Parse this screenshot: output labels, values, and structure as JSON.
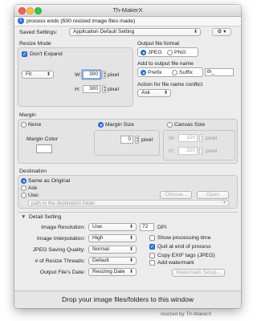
{
  "window": {
    "title": "Th-MakerX"
  },
  "info": {
    "message": "process ends (500 resized image files made)"
  },
  "saved_settings": {
    "label": "Saved Settings:",
    "value": "Application Default Setting"
  },
  "gear_menu": {
    "label": "⚙ ▾"
  },
  "resize_mode": {
    "title": "Resize Mode",
    "dont_expand": {
      "label": "Don't Expand",
      "checked": true
    },
    "fit_value": "Fit",
    "width_label": "W:",
    "width_value": "300",
    "width_unit": "pixel",
    "height_label": "H:",
    "height_value": "300",
    "height_unit": "pixel"
  },
  "output_format": {
    "title": "Output file format",
    "jpeg": "JPEG",
    "png": "PNG",
    "selected": "JPEG"
  },
  "add_to_name": {
    "title": "Add to output file name",
    "prefix": "Prefix",
    "suffix": "Suffix",
    "selected": "Prefix",
    "text_value": "th_"
  },
  "conflict": {
    "title": "Action for file name conflict",
    "value": "Ask"
  },
  "margin": {
    "title": "Margin",
    "none": "None",
    "margin_size": "Margin Size",
    "canvas_size": "Canvas Size",
    "selected": "Margin Size",
    "margin_color_label": "Margin Color",
    "margin_value": "0",
    "margin_unit": "pixel",
    "canvas_w_label": "W:",
    "canvas_w_value": "320",
    "canvas_w_unit": "pixel",
    "canvas_h_label": "H:",
    "canvas_h_value": "320",
    "canvas_h_unit": "pixel"
  },
  "destination": {
    "title": "Destination",
    "same": "Same as Original",
    "ask": "Ask",
    "use": "Use:",
    "selected": "Same as Original",
    "choose_label": "Choose...",
    "open_label": "Open",
    "path_placeholder": "path to the destination folder"
  },
  "detail": {
    "title": "Detail Setting",
    "resolution_label": "Image Resolution:",
    "resolution_value": "Use:",
    "dpi_value": "72",
    "dpi_unit": "DPI",
    "interpolation_label": "Image Interpolation:",
    "interpolation_value": "High",
    "jpeg_quality_label": "JPEG Saving Quality:",
    "jpeg_quality_value": "Normal",
    "threads_label": "# of Resize Threads:",
    "threads_value": "Default",
    "date_label": "Output File's Date:",
    "date_value": "Resizing Date",
    "show_time": {
      "label": "Show processing time",
      "checked": false
    },
    "quit_end": {
      "label": "Quit at end of process",
      "checked": true
    },
    "copy_exif": {
      "label": "Copy EXIF tags (JPEG)",
      "checked": false
    },
    "add_watermark": {
      "label": "Add watermark",
      "checked": false
    },
    "watermark_setup": "Watermark Setup..."
  },
  "drop_zone": {
    "text": "Drop your image files/folders to this window"
  },
  "footer": {
    "credit": "resized by Th-MakerX"
  },
  "colors": {
    "accent": "#2f7ee8",
    "close": "#fc605c",
    "minimize": "#fdbc40",
    "zoom": "#34c84a"
  },
  "icons": {
    "info": "info-icon",
    "gear": "gear-icon",
    "disclosure": "disclosure-triangle-icon"
  }
}
